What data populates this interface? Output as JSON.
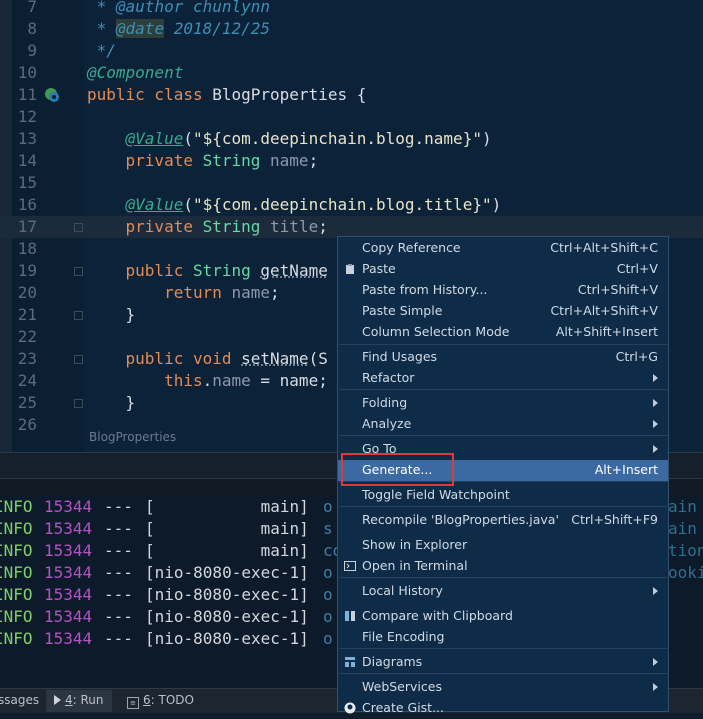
{
  "editor": {
    "lines": [
      {
        "n": "7",
        "tokens": [
          {
            "c": "t-doc",
            "t": " * "
          },
          {
            "c": "t-doc",
            "t": "@author chunlynn"
          }
        ]
      },
      {
        "n": "8",
        "tokens": [
          {
            "c": "t-doc",
            "t": " * "
          },
          {
            "c": "t-doc-tag",
            "t": "@date"
          },
          {
            "c": "t-doc",
            "t": " 2018/12/25"
          }
        ]
      },
      {
        "n": "9",
        "tokens": [
          {
            "c": "t-doc",
            "t": " */"
          }
        ]
      },
      {
        "n": "10",
        "tokens": [
          {
            "c": "t-ann",
            "t": "@Component"
          }
        ]
      },
      {
        "n": "11",
        "tokens": [
          {
            "c": "t-kw",
            "t": "public class "
          },
          {
            "c": "t-plain",
            "t": "BlogProperties {"
          }
        ]
      },
      {
        "n": "12",
        "tokens": []
      },
      {
        "n": "13",
        "tokens": [
          {
            "c": "t-plain",
            "t": "    "
          },
          {
            "c": "t-ann-u",
            "t": "@Value"
          },
          {
            "c": "t-plain",
            "t": "("
          },
          {
            "c": "t-str",
            "t": "\"${com.deepinchain.blog.name}\""
          },
          {
            "c": "t-plain",
            "t": ")"
          }
        ]
      },
      {
        "n": "14",
        "tokens": [
          {
            "c": "t-plain",
            "t": "    "
          },
          {
            "c": "t-kw",
            "t": "private "
          },
          {
            "c": "t-type",
            "t": "String "
          },
          {
            "c": "t-field",
            "t": "name"
          },
          {
            "c": "t-plain",
            "t": ";"
          }
        ]
      },
      {
        "n": "15",
        "tokens": []
      },
      {
        "n": "16",
        "tokens": [
          {
            "c": "t-plain",
            "t": "    "
          },
          {
            "c": "t-ann-u",
            "t": "@Value"
          },
          {
            "c": "t-plain",
            "t": "("
          },
          {
            "c": "t-str",
            "t": "\"${com.deepinchain.blog.title}\""
          },
          {
            "c": "t-plain",
            "t": ")"
          }
        ]
      },
      {
        "n": "17",
        "current": true,
        "tokens": [
          {
            "c": "t-plain",
            "t": "    "
          },
          {
            "c": "t-kw",
            "t": "private "
          },
          {
            "c": "t-type",
            "t": "String "
          },
          {
            "c": "t-field",
            "t": "title"
          },
          {
            "c": "t-plain",
            "t": ";"
          }
        ]
      },
      {
        "n": "18",
        "tokens": []
      },
      {
        "n": "19",
        "tokens": [
          {
            "c": "t-plain",
            "t": "    "
          },
          {
            "c": "t-kw",
            "t": "public "
          },
          {
            "c": "t-type",
            "t": "String "
          },
          {
            "c": "t-meth",
            "t": "getName"
          }
        ]
      },
      {
        "n": "20",
        "tokens": [
          {
            "c": "t-plain",
            "t": "        "
          },
          {
            "c": "t-kw",
            "t": "return "
          },
          {
            "c": "t-field",
            "t": "name"
          },
          {
            "c": "t-plain",
            "t": ";"
          }
        ]
      },
      {
        "n": "21",
        "tokens": [
          {
            "c": "t-plain",
            "t": "    }"
          }
        ]
      },
      {
        "n": "22",
        "tokens": []
      },
      {
        "n": "23",
        "tokens": [
          {
            "c": "t-plain",
            "t": "    "
          },
          {
            "c": "t-kw",
            "t": "public void "
          },
          {
            "c": "t-meth",
            "t": "setName"
          },
          {
            "c": "t-plain",
            "t": "(S"
          }
        ]
      },
      {
        "n": "24",
        "tokens": [
          {
            "c": "t-plain",
            "t": "        "
          },
          {
            "c": "t-this",
            "t": "this"
          },
          {
            "c": "t-plain",
            "t": "."
          },
          {
            "c": "t-field",
            "t": "name"
          },
          {
            "c": "t-plain",
            "t": " = name;"
          }
        ]
      },
      {
        "n": "25",
        "tokens": [
          {
            "c": "t-plain",
            "t": "    }"
          }
        ]
      },
      {
        "n": "26",
        "tokens": []
      }
    ],
    "breadcrumb": "BlogProperties"
  },
  "console": {
    "lines": [
      {
        "level": "INFO",
        "pid": "15344",
        "dash": "---",
        "thread": "[           main]",
        "rest": "o",
        "tail": "ain"
      },
      {
        "level": "INFO",
        "pid": "15344",
        "dash": "---",
        "thread": "[           main]",
        "rest": "s",
        "tail": "ain"
      },
      {
        "level": "INFO",
        "pid": "15344",
        "dash": "---",
        "thread": "[           main]",
        "rest": "co",
        "tail": "tion"
      },
      {
        "level": "INFO",
        "pid": "15344",
        "dash": "---",
        "thread": "[nio-8080-exec-1]",
        "rest": "o",
        "tail": "ooki"
      },
      {
        "level": "INFO",
        "pid": "15344",
        "dash": "---",
        "thread": "[nio-8080-exec-1]",
        "rest": "o",
        "tail": ""
      },
      {
        "level": "INFO",
        "pid": "15344",
        "dash": "---",
        "thread": "[nio-8080-exec-1]",
        "rest": "o",
        "tail": ""
      },
      {
        "level": "INFO",
        "pid": "15344",
        "dash": "---",
        "thread": "[nio-8080-exec-1]",
        "rest": "o",
        "tail": ""
      }
    ]
  },
  "toolbar": {
    "messages_label": "ssages",
    "run_mnemonic": "4",
    "run_label": ": Run",
    "todo_mnemonic": "6",
    "todo_label": ": TODO"
  },
  "menu": {
    "items": [
      {
        "id": "copy-reference",
        "label": "Copy Reference",
        "shortcut": "Ctrl+Alt+Shift+C"
      },
      {
        "id": "paste",
        "label": "Paste",
        "shortcut": "Ctrl+V",
        "icon": "clipboard-icon"
      },
      {
        "id": "paste-from-history",
        "label": "Paste from History...",
        "shortcut": "Ctrl+Shift+V"
      },
      {
        "id": "paste-simple",
        "label": "Paste Simple",
        "shortcut": "Ctrl+Alt+Shift+V"
      },
      {
        "id": "column-selection-mode",
        "label": "Column Selection Mode",
        "shortcut": "Alt+Shift+Insert"
      },
      {
        "id": "find-usages",
        "label": "Find Usages",
        "shortcut": "Ctrl+G"
      },
      {
        "id": "refactor",
        "label": "Refactor",
        "submenu": true
      },
      {
        "id": "folding",
        "label": "Folding",
        "submenu": true
      },
      {
        "id": "analyze",
        "label": "Analyze",
        "submenu": true
      },
      {
        "id": "go-to",
        "label": "Go To",
        "submenu": true
      },
      {
        "id": "generate",
        "label": "Generate...",
        "shortcut": "Alt+Insert",
        "selected": true
      },
      {
        "id": "toggle-field-watchpoint",
        "label": "Toggle Field Watchpoint"
      },
      {
        "id": "recompile",
        "label": "Recompile 'BlogProperties.java'",
        "shortcut": "Ctrl+Shift+F9"
      },
      {
        "id": "show-in-explorer",
        "label": "Show in Explorer"
      },
      {
        "id": "open-in-terminal",
        "label": "Open in Terminal",
        "icon": "terminal-icon"
      },
      {
        "id": "local-history",
        "label": "Local History",
        "submenu": true
      },
      {
        "id": "compare-with-clipboard",
        "label": "Compare with Clipboard",
        "icon": "compare-icon"
      },
      {
        "id": "file-encoding",
        "label": "File Encoding"
      },
      {
        "id": "diagrams",
        "label": "Diagrams",
        "submenu": true,
        "icon": "diagram-icon"
      },
      {
        "id": "webservices",
        "label": "WebServices",
        "submenu": true
      },
      {
        "id": "create-gist",
        "label": "Create Gist...",
        "icon": "github-icon"
      }
    ]
  },
  "colors": {
    "editor_bg": "#0c2239",
    "menu_bg": "#0e2b47",
    "menu_selected": "#3b6aa3",
    "highlight_box": "#e0393a"
  }
}
